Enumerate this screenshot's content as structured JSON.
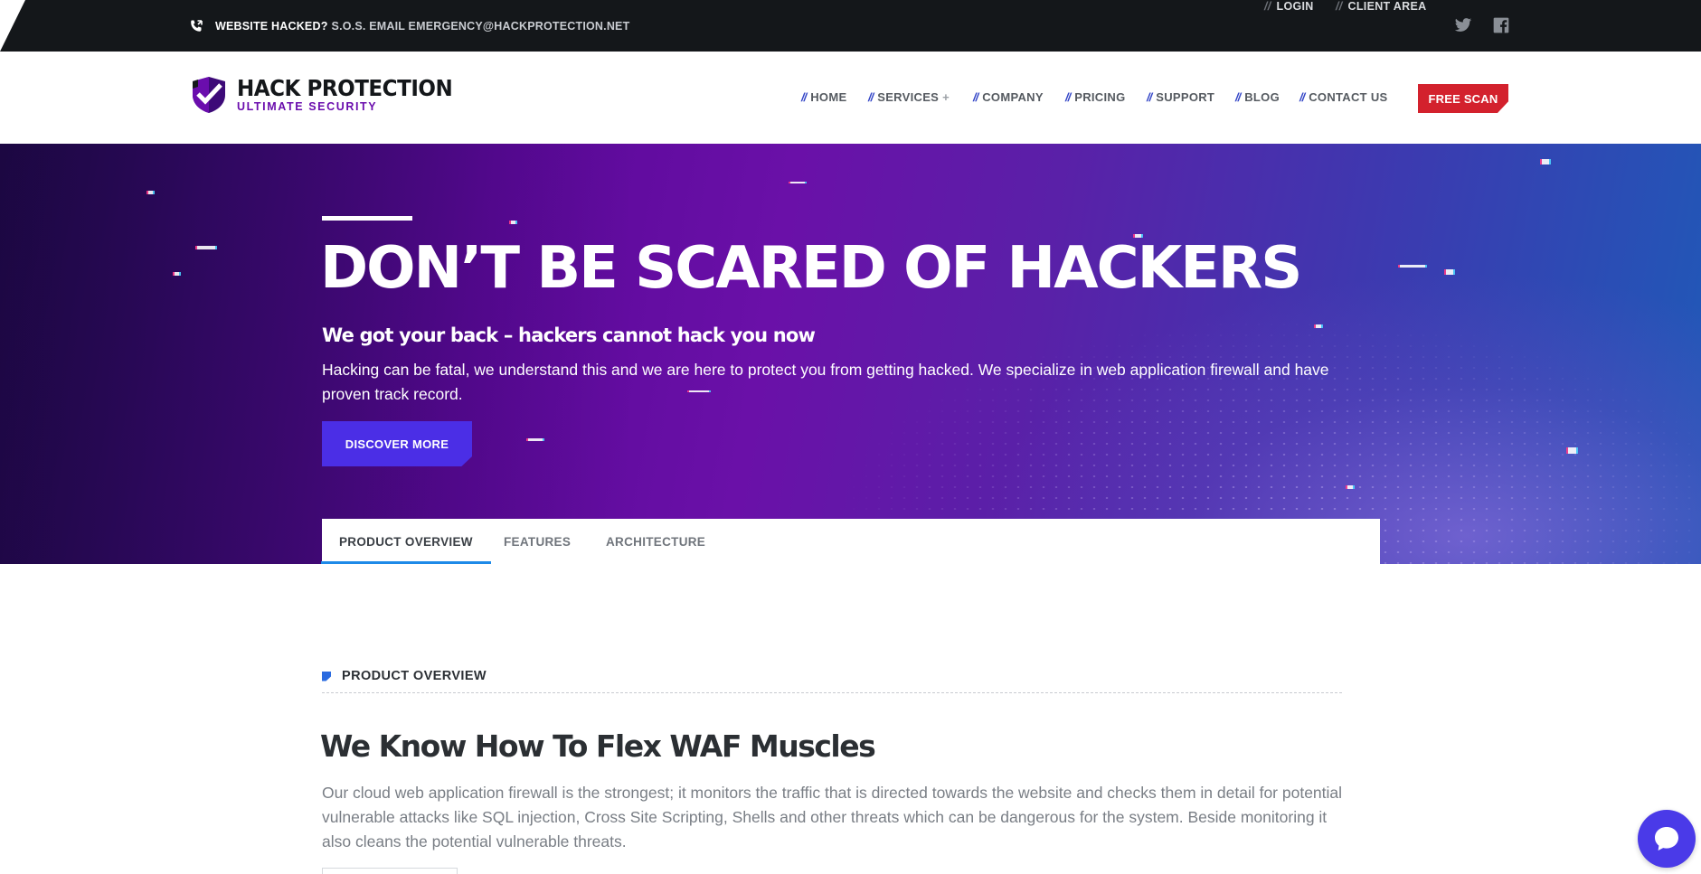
{
  "topbar": {
    "alert_strong": "WEBSITE HACKED?",
    "alert_rest": "S.O.S. EMAIL EMERGENCY@HACKPROTECTION.NET",
    "links": [
      {
        "label": "LOGIN"
      },
      {
        "label": "CLIENT AREA"
      }
    ],
    "social": [
      "twitter-icon",
      "facebook-icon"
    ]
  },
  "logo": {
    "name": "HACK PROTECTION",
    "tagline": "ULTIMATE SECURITY"
  },
  "nav": {
    "items": [
      {
        "label": "HOME"
      },
      {
        "label": "SERVICES",
        "has_submenu": true
      },
      {
        "label": "COMPANY"
      },
      {
        "label": "PRICING"
      },
      {
        "label": "SUPPORT"
      },
      {
        "label": "BLOG"
      },
      {
        "label": "CONTACT US"
      }
    ],
    "cta": "FREE SCAN"
  },
  "hero": {
    "title": "DON’T BE SCARED OF HACKERS",
    "subtitle": "We got your back – hackers cannot hack you now",
    "text": "Hacking can be fatal, we understand this and we are here to protect you from getting hacked. We specialize in web application firewall and have proven track record.",
    "button": "DISCOVER MORE"
  },
  "tabs": [
    {
      "label": "PRODUCT OVERVIEW",
      "active": true
    },
    {
      "label": "FEATURES",
      "active": false
    },
    {
      "label": "ARCHITECTURE",
      "active": false
    }
  ],
  "content": {
    "section_label": "PRODUCT OVERVIEW",
    "title": "We Know How To Flex WAF Muscles",
    "text": "Our cloud web application firewall is the strongest; it monitors the traffic that is directed towards the website and checks them in detail for potential vulnerable attacks like SQL injection, Cross Site Scripting, Shells and other threats which can be dangerous for the system. Beside monitoring it also cleans the potential vulnerable threats."
  },
  "colors": {
    "topbar_bg": "#14171a",
    "accent_blue": "#3345c7",
    "cta_red": "#d3212d",
    "hero_button": "#4b2ee6",
    "tab_underline": "#1e8ae8",
    "brand_purple": "#6a0dad",
    "chat_bubble": "#4a3ae8"
  }
}
